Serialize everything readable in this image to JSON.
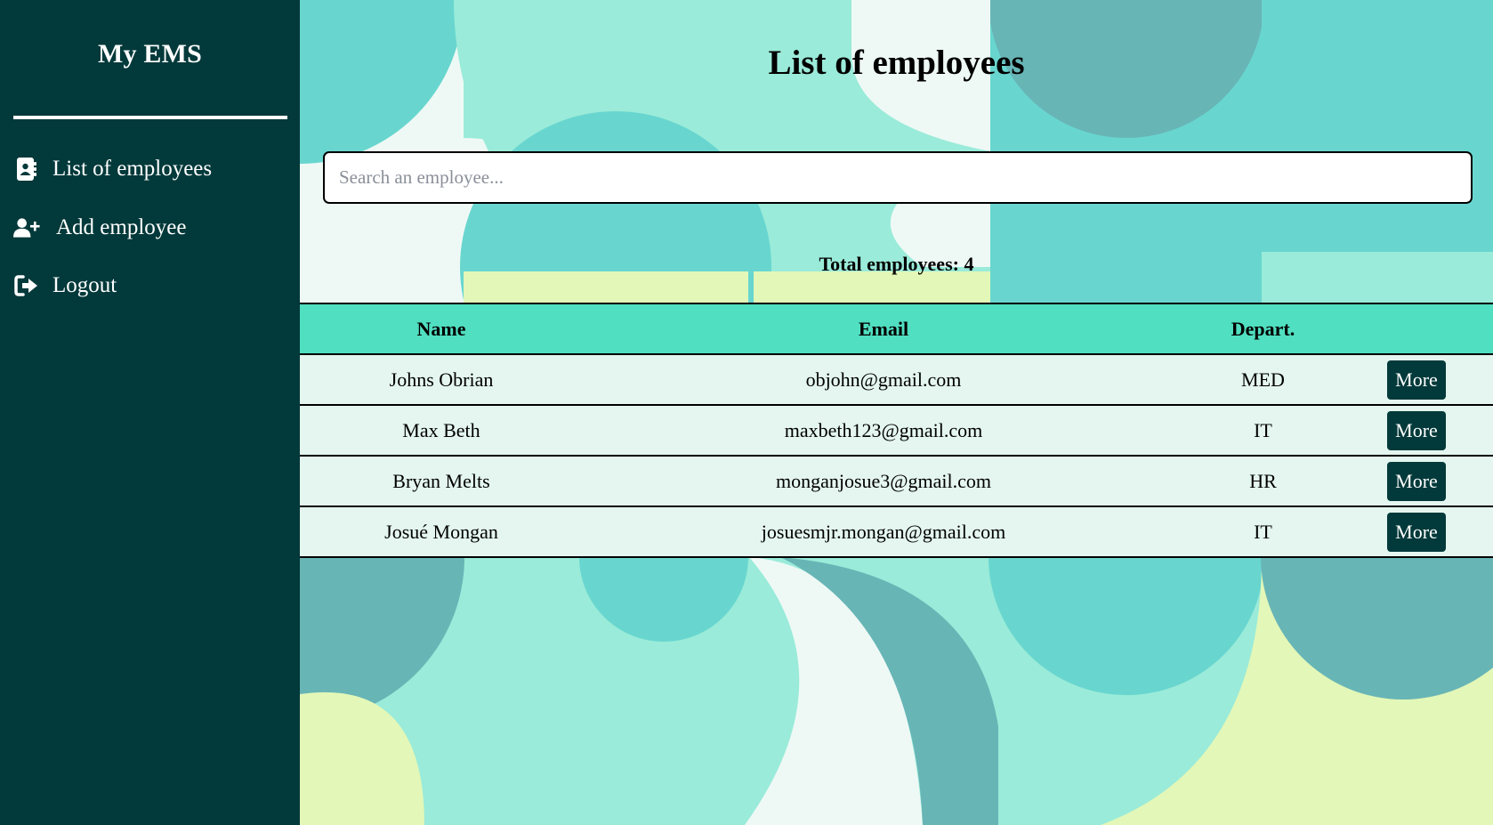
{
  "sidebar": {
    "brand": "My EMS",
    "items": [
      {
        "label": "List of employees",
        "icon": "address-book-icon"
      },
      {
        "label": "Add employee",
        "icon": "user-plus-icon"
      },
      {
        "label": "Logout",
        "icon": "logout-icon"
      }
    ]
  },
  "main": {
    "title": "List of employees",
    "search": {
      "placeholder": "Search an employee...",
      "value": ""
    },
    "total_label": "Total employees: 4",
    "table": {
      "headers": [
        "Name",
        "Email",
        "Depart.",
        ""
      ],
      "rows": [
        {
          "name": "Johns Obrian",
          "email": "objohn@gmail.com",
          "dept": "MED",
          "action": "More"
        },
        {
          "name": "Max Beth",
          "email": "maxbeth123@gmail.com",
          "dept": "IT",
          "action": "More"
        },
        {
          "name": "Bryan Melts",
          "email": "monganjosue3@gmail.com",
          "dept": "HR",
          "action": "More"
        },
        {
          "name": "Josué Mongan",
          "email": "josuesmjr.mongan@gmail.com",
          "dept": "IT",
          "action": "More"
        }
      ]
    }
  },
  "colors": {
    "sidebar_bg": "#02393a",
    "table_header_bg": "#50dfc0",
    "row_bg": "#e4f6ef",
    "button_bg": "#02393a"
  }
}
